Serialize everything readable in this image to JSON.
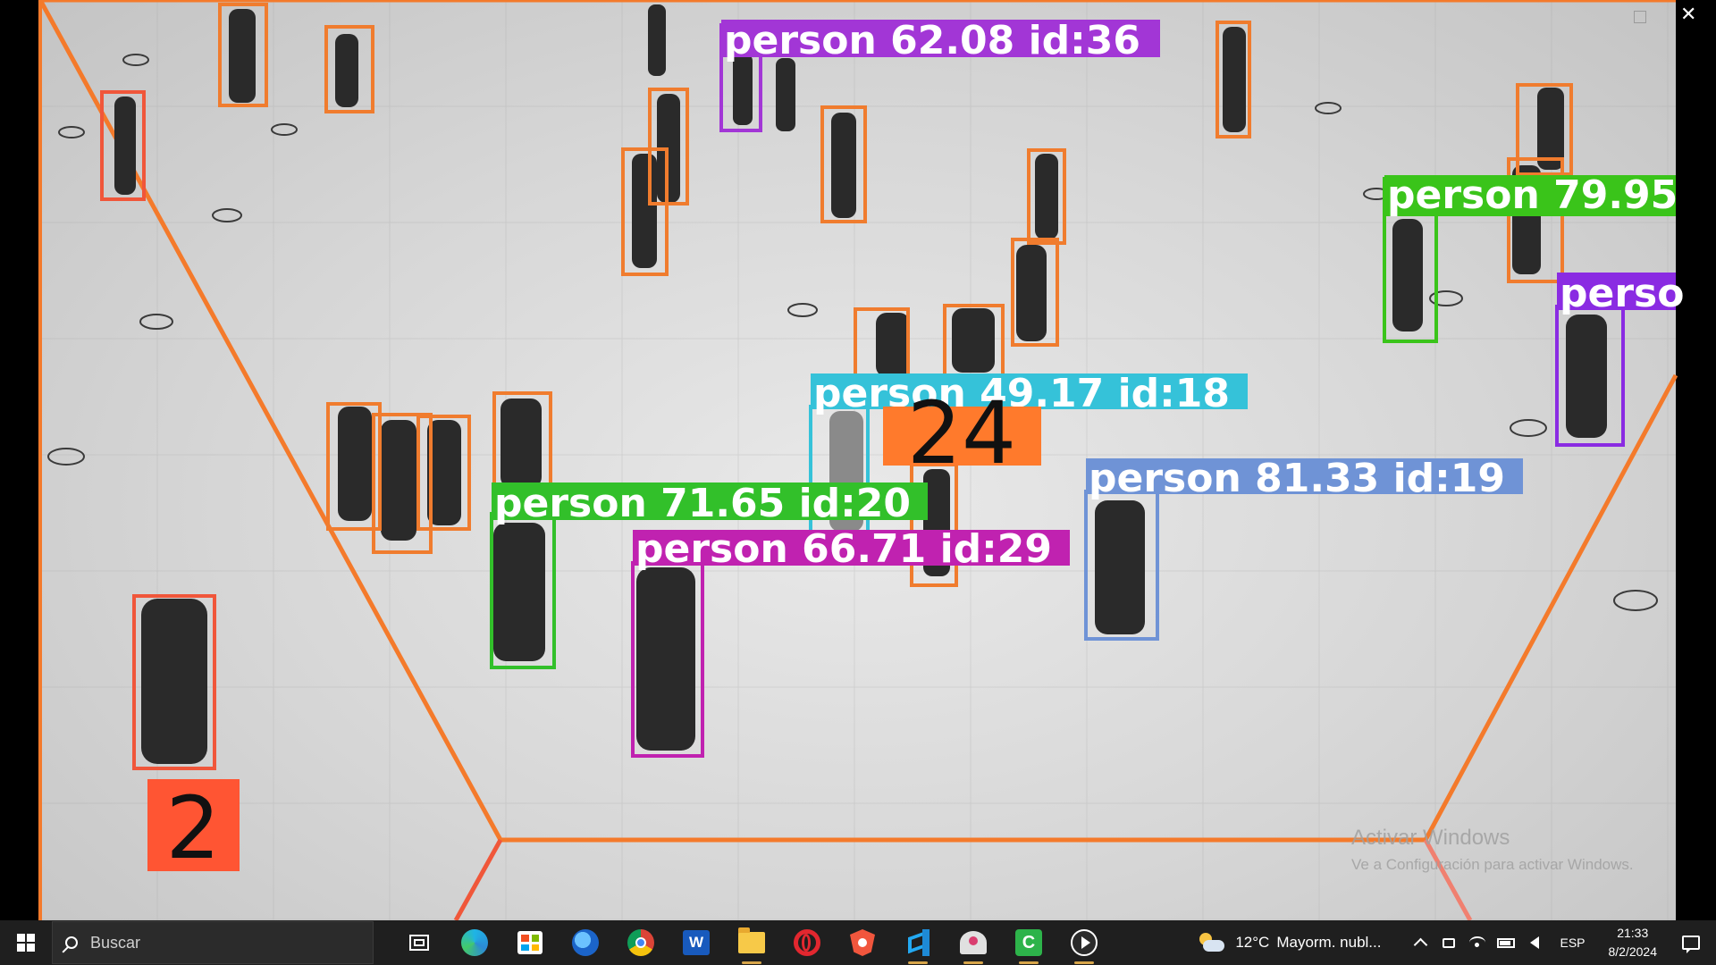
{
  "video": {
    "zone_count_label": "2",
    "center_count_label": "24",
    "detections": [
      {
        "label": "person 62.08 id:36",
        "color": "#a236d6"
      },
      {
        "label": "person 79.95",
        "color": "#3ac41a"
      },
      {
        "label": "perso",
        "color": "#8a2be2"
      },
      {
        "label": "person 49.17 id:18",
        "color": "#35c2d9"
      },
      {
        "label": "person 71.65 id:20",
        "color": "#32c02a"
      },
      {
        "label": "person 81.33 id:19",
        "color": "#6f93d6"
      },
      {
        "label": "person 66.71 id:29",
        "color": "#c022b0"
      }
    ],
    "box_color": "#f07c2e",
    "zone_line_color": "#f47a2b",
    "count_box_color_left": "#ff5533",
    "count_box_color_center": "#ff7a2c"
  },
  "watermark": {
    "title": "Activar Windows",
    "subtitle": "Ve a Configuración para activar Windows."
  },
  "taskbar": {
    "search_placeholder": "Buscar",
    "apps": [
      {
        "name": "task-view-icon"
      },
      {
        "name": "edge-icon"
      },
      {
        "name": "store-icon"
      },
      {
        "name": "thunderbird-icon"
      },
      {
        "name": "chrome-icon"
      },
      {
        "name": "word-icon",
        "glyph": "W"
      },
      {
        "name": "folder-icon"
      },
      {
        "name": "opera-icon"
      },
      {
        "name": "brave-icon"
      },
      {
        "name": "vscode-icon"
      },
      {
        "name": "snip-icon"
      },
      {
        "name": "camtasia-icon",
        "glyph": "C"
      },
      {
        "name": "player-icon"
      }
    ],
    "weather": {
      "temp": "12°C",
      "desc": "Mayorm. nubl..."
    },
    "language": "ESP",
    "time": "21:33",
    "date": "8/2/2024"
  }
}
